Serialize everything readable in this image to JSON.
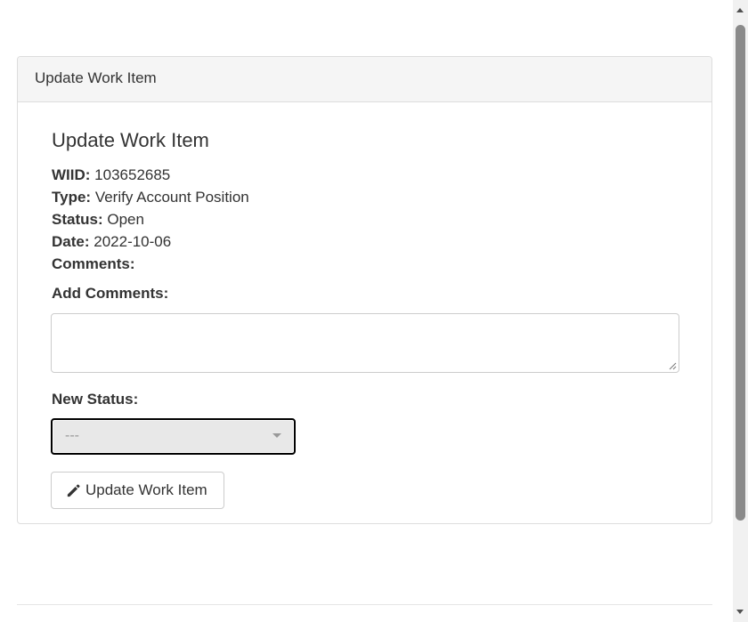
{
  "panel": {
    "heading": "Update Work Item"
  },
  "form": {
    "title": "Update Work Item",
    "fields": [
      {
        "label": "WIID:",
        "value": "103652685"
      },
      {
        "label": "Type:",
        "value": "Verify Account Position"
      },
      {
        "label": "Status:",
        "value": "Open"
      },
      {
        "label": "Date:",
        "value": "2022-10-06"
      },
      {
        "label": "Comments:",
        "value": ""
      }
    ],
    "add_comments_label": "Add Comments:",
    "add_comments_value": "",
    "new_status_label": "New Status:",
    "new_status_selected": "---",
    "submit_label": "Update Work Item",
    "submit_icon": "pencil-icon"
  },
  "colors": {
    "panel_heading_bg": "#f5f5f5",
    "border": "#dddddd",
    "select_bg": "#e8e8e8",
    "text": "#333333"
  }
}
